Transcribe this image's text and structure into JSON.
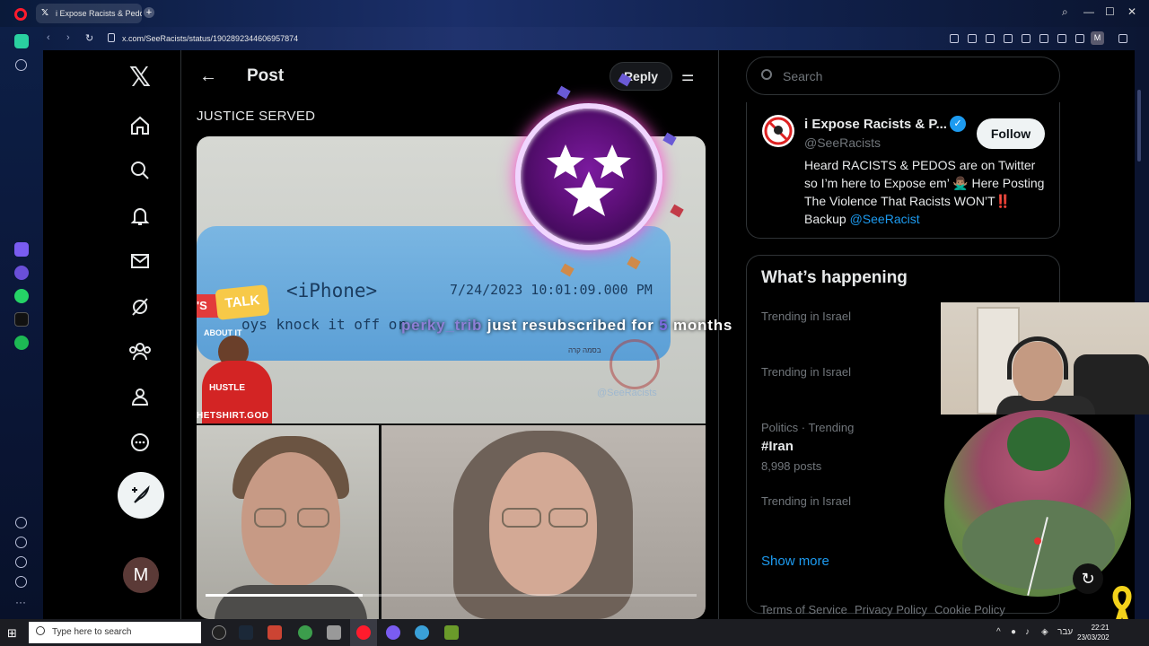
{
  "browser": {
    "tab_title": "i Expose Racists & Pedo",
    "url": "x.com/SeeRacists/status/1902892344606957874",
    "profile_letter": "M"
  },
  "x_nav": {
    "avatar_letter": "M"
  },
  "post": {
    "header_title": "Post",
    "reply_label": "Reply",
    "text": "JUSTICE SERVED",
    "progress_fraction": 0.32,
    "media": {
      "card_device": "<iPhone>",
      "card_timestamp": "7/24/2023 10:01:09.000 PM",
      "card_line": "oys knock it off or",
      "lets": "'S",
      "talk": "TALK",
      "about_it": "ABOUT IT",
      "hustle": "HUSTLE",
      "hetshirt": "HETSHIRT.GOD",
      "watermark": "@SeeRacists",
      "hebrew": "בסמה קרה"
    }
  },
  "sub_alert": {
    "username": "perky_trib",
    "middle": " just resubscribed for ",
    "months": "5",
    "tail": " months"
  },
  "sidebar": {
    "search_placeholder": "Search",
    "profile": {
      "name": "i Expose Racists & P...",
      "handle": "@SeeRacists",
      "follow_label": "Follow",
      "bio": "Heard RACISTS & PEDOS are on Twitter so I’m here to Expose em’ 🙅🏽‍♂️ Here Posting The Violence That Racists WON’T‼️ Backup ",
      "bio_link": "@SeeRacist"
    },
    "happening": {
      "title": "What’s happening",
      "trends": [
        {
          "category": "Trending in Israel",
          "name": "",
          "posts": ""
        },
        {
          "category": "Trending in Israel",
          "name": "",
          "posts": ""
        },
        {
          "category": "Politics · Trending",
          "name": "#Iran",
          "posts": "8,998 posts"
        },
        {
          "category": "Trending in Israel",
          "name": "",
          "posts": ""
        }
      ],
      "show_more": "Show more"
    },
    "footer": [
      "Terms of Service",
      "Privacy Policy",
      "Cookie Policy"
    ]
  },
  "taskbar": {
    "search_placeholder": "Type here to search",
    "lang": "עבר",
    "time": "22:21",
    "date": "23/03/202"
  }
}
